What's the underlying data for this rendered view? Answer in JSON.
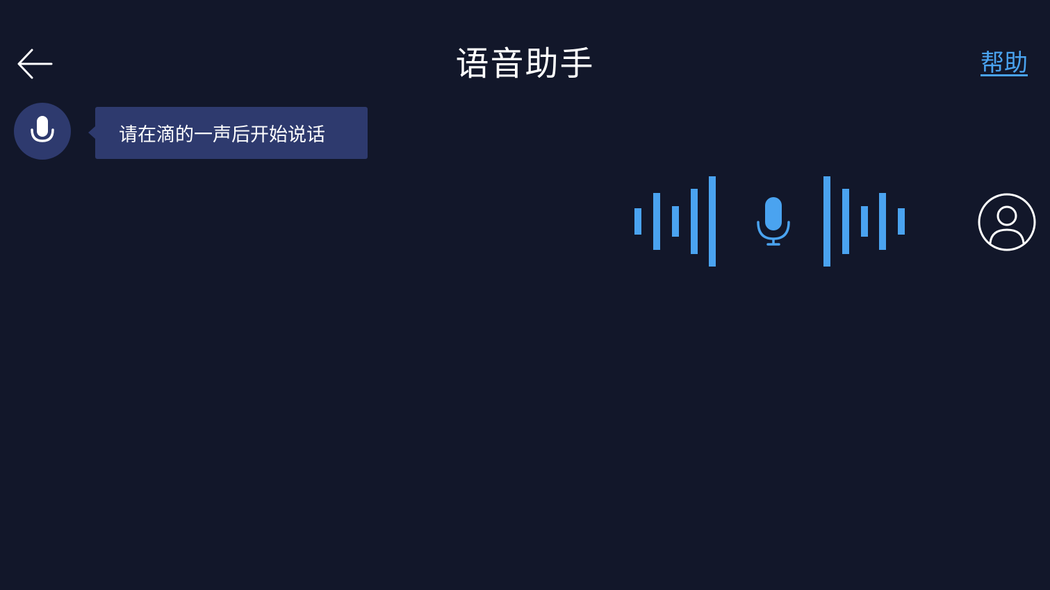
{
  "header": {
    "title": "语音助手",
    "help_label": "帮助",
    "back_icon": "arrow-left-icon"
  },
  "assistant": {
    "icon": "microphone-icon",
    "prompt": "请在滴的一声后开始说话"
  },
  "voice_input": {
    "icon": "microphone-icon",
    "status": "listening"
  },
  "user": {
    "icon": "user-avatar-icon"
  },
  "colors": {
    "background": "#12172a",
    "bubble": "#2e3a6e",
    "accent": "#4aa3f0",
    "text": "#ffffff"
  }
}
